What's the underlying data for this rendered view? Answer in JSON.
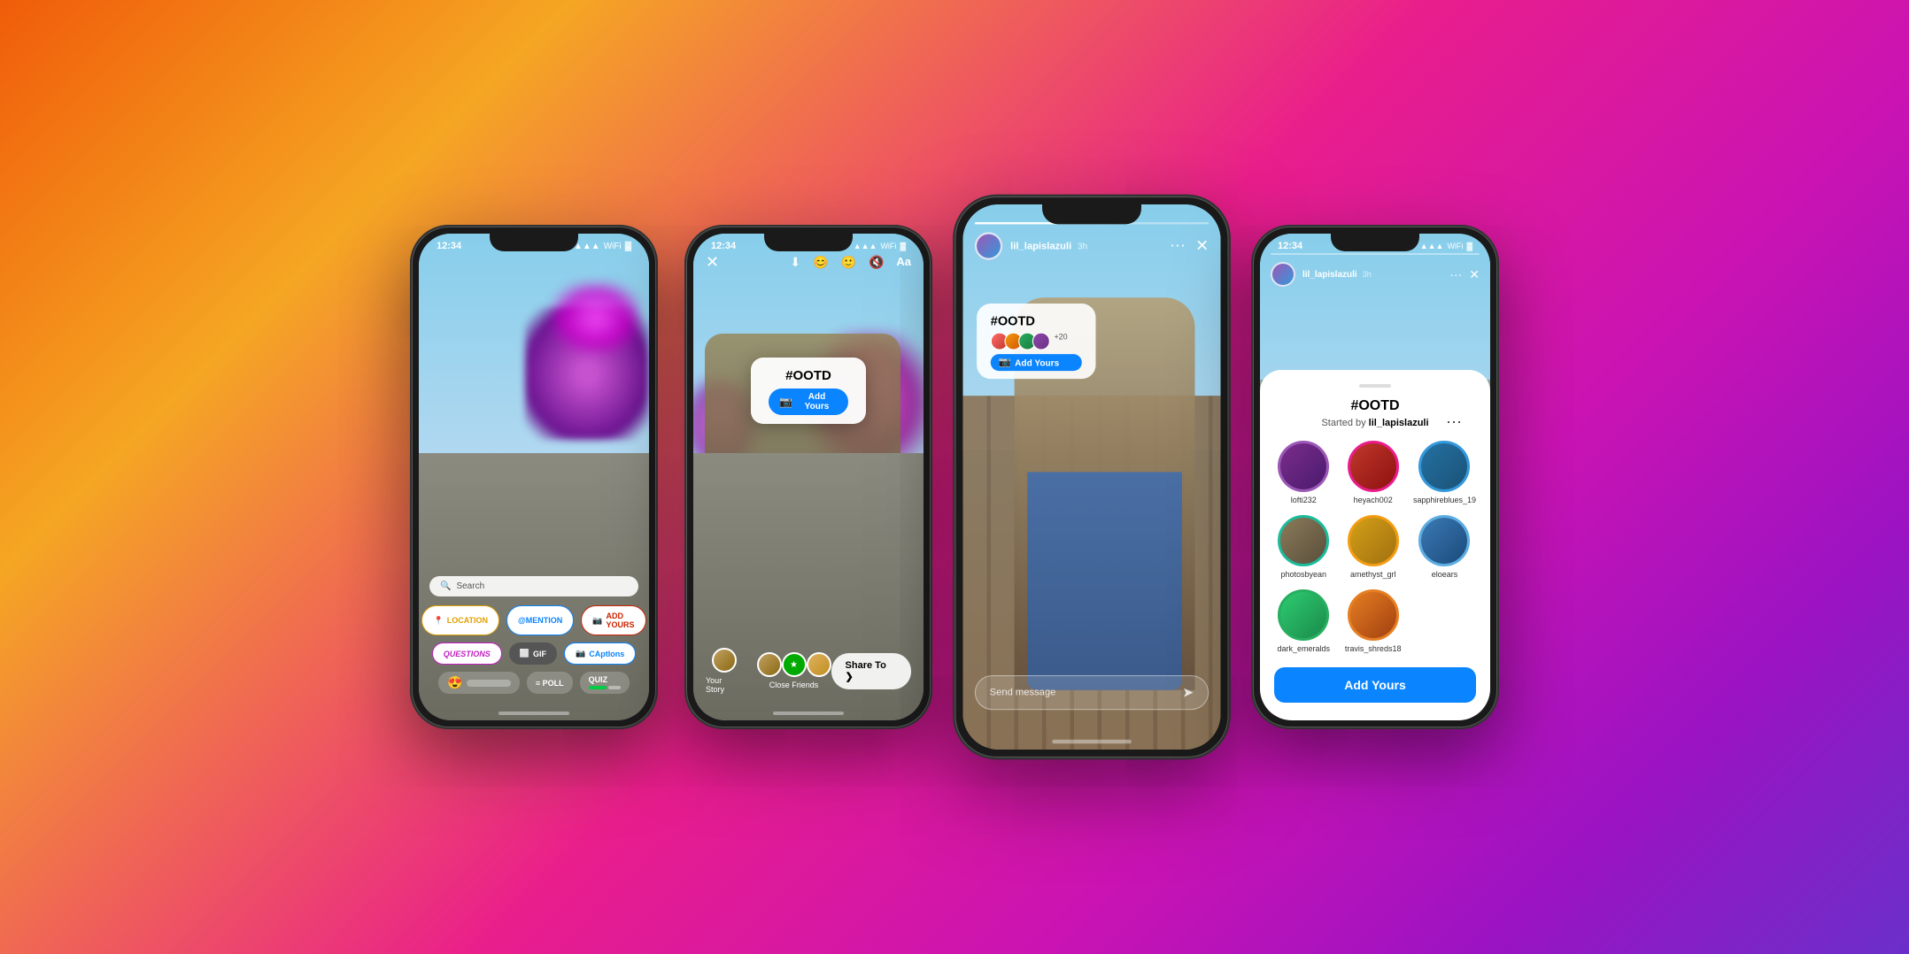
{
  "background": {
    "gradient": "linear-gradient(135deg, #f05c0a 0%, #f5a623 20%, #e91e8c 50%, #c913b3 70%, #9b13c3 85%, #6b2fc9 100%)"
  },
  "phone1": {
    "status_time": "12:34",
    "search_placeholder": "Search",
    "stickers": {
      "location": "LOCATION",
      "mention": "@MENTION",
      "add_yours": "ADD YOURS",
      "questions": "QUESTIONS",
      "gif": "GIF",
      "captions": "CAptIons",
      "emoji": "😍",
      "poll": "≡ POLL",
      "quiz": "QUIZ"
    }
  },
  "phone2": {
    "status_time": "12:34",
    "hashtag": "#OOTD",
    "add_yours_label": "Add Yours",
    "your_story_label": "Your Story",
    "close_friends_label": "Close Friends",
    "share_to_label": "Share To ❯"
  },
  "phone3": {
    "status_time": "12:34",
    "username": "lil_lapislazuli",
    "time_ago": "3h",
    "hashtag": "#OOTD",
    "add_yours_label": "Add Yours",
    "plus_count": "+20",
    "message_placeholder": "Send message"
  },
  "phone4": {
    "status_time": "12:34",
    "username": "lil_lapislazuli",
    "hashtag": "#OOTD",
    "started_by_label": "Started by",
    "started_by_user": "lil_lapislazuli",
    "add_yours_btn": "Add Yours",
    "participants": [
      {
        "name": "lofti232",
        "ring": "ring-purple"
      },
      {
        "name": "heyach002",
        "ring": "ring-pink"
      },
      {
        "name": "sapphireblues_19",
        "ring": "ring-blue"
      },
      {
        "name": "photosbyean",
        "ring": "ring-teal"
      },
      {
        "name": "amethyst_grl",
        "ring": "ring-gold"
      },
      {
        "name": "eloears",
        "ring": "ring-light-blue"
      },
      {
        "name": "dark_emeralds",
        "ring": "ring-green"
      },
      {
        "name": "travis_shreds18",
        "ring": "ring-orange"
      }
    ]
  }
}
